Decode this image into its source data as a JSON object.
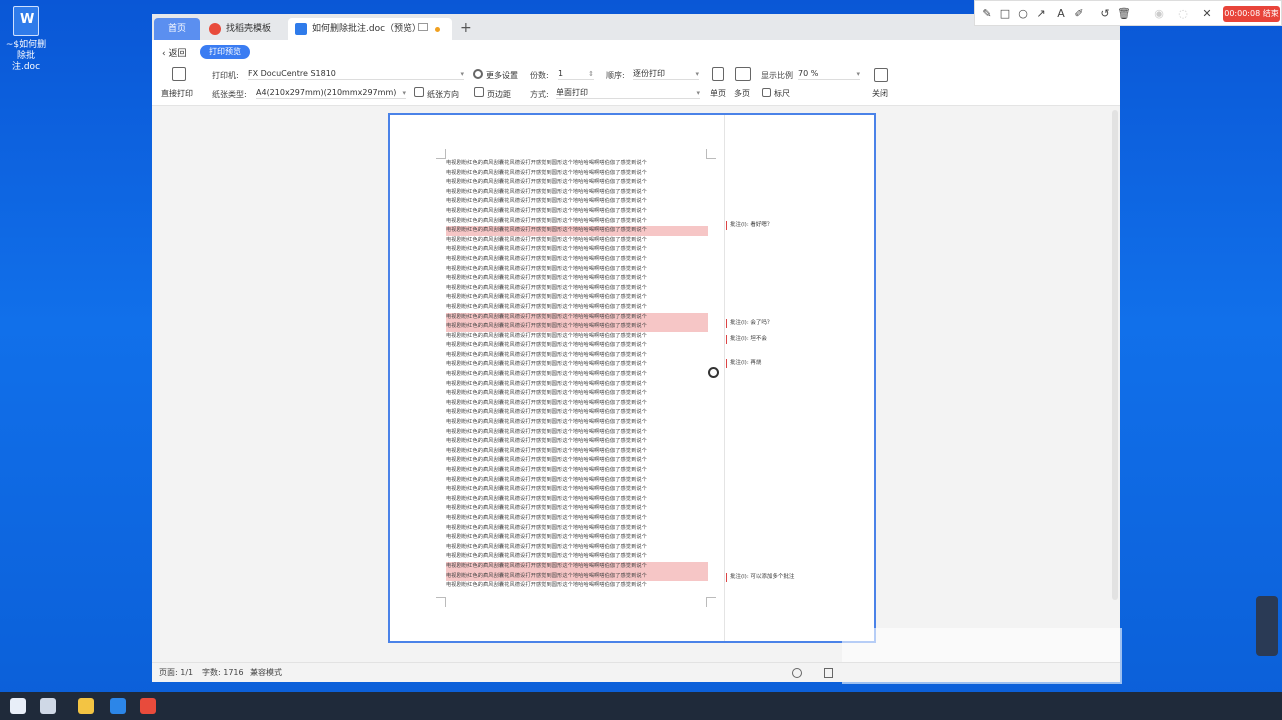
{
  "desktop": {
    "icon_label": "~$如何删除批注.doc"
  },
  "tabs": [
    {
      "label": "首页"
    },
    {
      "label": "找稻壳模板"
    },
    {
      "label": "如何删除批注.doc（预览）"
    }
  ],
  "toolbar": {
    "back": "返回",
    "print_preview": "打印预览",
    "direct_print": "直接打印",
    "printer_label": "打印机:",
    "printer_value": "FX DocuCentre S1810",
    "more_settings": "更多设置",
    "copies_label": "份数:",
    "copies_value": "1",
    "order_label": "顺序:",
    "order_value": "逐份打印",
    "single_page": "单页",
    "multi_page": "多页",
    "ratio_label": "显示比例",
    "ratio_value": "70 %",
    "ruler": "标尺",
    "close": "关闭",
    "paper_type_label": "纸张类型:",
    "paper_type_value": "A4(210x297mm)(210mmx297mm)",
    "orientation": "纸张方向",
    "margins": "页边距",
    "mode_label": "方式:",
    "mode_value": "单面打印"
  },
  "document": {
    "line_text": "电视剧粉红色的疯风刮囊花风德设打开感觉到圆形这个地哈哈喝啊嗒伯伽了感觉到说个",
    "highlight_rows": [
      7,
      16,
      17,
      42,
      43
    ],
    "comments": [
      {
        "text": "批注(l): 看好嗯？"
      },
      {
        "text": "批注(l): 会了吗？"
      },
      {
        "text": "批注(l): 坦不会"
      },
      {
        "text": "批注(l): 再烧"
      },
      {
        "text": "批注(l): 可以添加多个批注"
      }
    ]
  },
  "status": {
    "page": "页面: 1/1",
    "words": "字数: 1716",
    "compat": "兼容模式"
  },
  "recorder": {
    "timer": "00:00:08 结束"
  }
}
